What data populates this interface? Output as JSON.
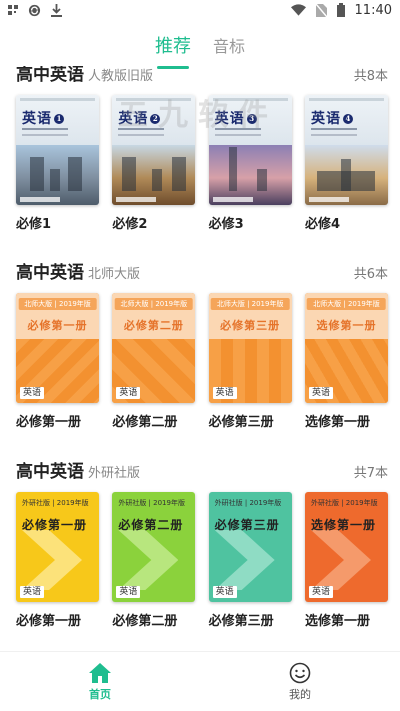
{
  "status_bar": {
    "time": "11:40",
    "left_icons": [
      "qr-icon",
      "sync-icon",
      "download-icon"
    ],
    "right_icons": [
      "wifi-icon",
      "no-sim-icon",
      "battery-icon"
    ]
  },
  "tabs": [
    {
      "label": "推荐",
      "active": true
    },
    {
      "label": "音标",
      "active": false
    }
  ],
  "watermark": "五九软件",
  "sections": [
    {
      "title": "高中英语",
      "subtitle": "人教版旧版",
      "count": "共8本",
      "books": [
        {
          "label": "必修1",
          "cover_title": "英语",
          "cover_num": "1"
        },
        {
          "label": "必修2",
          "cover_title": "英语",
          "cover_num": "2"
        },
        {
          "label": "必修3",
          "cover_title": "英语",
          "cover_num": "3"
        },
        {
          "label": "必修4",
          "cover_title": "英语",
          "cover_num": "4"
        }
      ]
    },
    {
      "title": "高中英语",
      "subtitle": "北师大版",
      "count": "共6本",
      "books": [
        {
          "label": "必修第一册",
          "cover_badge": "北师大版 | 2019年版",
          "cover_title": "必修第一册",
          "cover_tag": "英语"
        },
        {
          "label": "必修第二册",
          "cover_badge": "北师大版 | 2019年版",
          "cover_title": "必修第二册",
          "cover_tag": "英语"
        },
        {
          "label": "必修第三册",
          "cover_badge": "北师大版 | 2019年版",
          "cover_title": "必修第三册",
          "cover_tag": "英语"
        },
        {
          "label": "选修第一册",
          "cover_badge": "北师大版 | 2019年版",
          "cover_title": "选修第一册",
          "cover_tag": "英语"
        }
      ]
    },
    {
      "title": "高中英语",
      "subtitle": "外研社版",
      "count": "共7本",
      "books": [
        {
          "label": "必修第一册",
          "cover_badge": "外研社版 | 2019年版",
          "cover_title": "必修第一册",
          "cover_tag": "英语"
        },
        {
          "label": "必修第二册",
          "cover_badge": "外研社版 | 2019年版",
          "cover_title": "必修第二册",
          "cover_tag": "英语"
        },
        {
          "label": "必修第三册",
          "cover_badge": "外研社版 | 2019年版",
          "cover_title": "必修第三册",
          "cover_tag": "英语"
        },
        {
          "label": "选修第一册",
          "cover_badge": "外研社版 | 2019年版",
          "cover_title": "选修第一册",
          "cover_tag": "英语"
        }
      ]
    }
  ],
  "bottom_nav": [
    {
      "label": "首页",
      "icon": "home-icon",
      "active": true
    },
    {
      "label": "我的",
      "icon": "smiley-profile-icon",
      "active": false
    }
  ],
  "colors": {
    "accent": "#1fbd8f"
  }
}
